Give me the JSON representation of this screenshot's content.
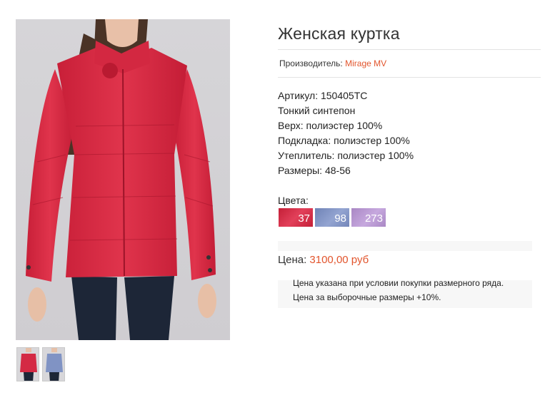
{
  "product": {
    "title": "Женская куртка",
    "manufacturer_label": "Производитель:",
    "manufacturer_name": "Mirage MV",
    "specs": [
      "Артикул: 150405ТС",
      "Тонкий синтепон",
      "Верх: полиэстер 100%",
      "Подкладка: полиэстер 100%",
      "Утеплитель: полиэстер 100%",
      "Размеры: 48-56"
    ],
    "colors_label": "Цвета:",
    "colors": [
      {
        "code": "37",
        "color": "#d42a44"
      },
      {
        "code": "98",
        "color": "#8093c4"
      },
      {
        "code": "273",
        "color": "#b797d1"
      }
    ],
    "price_label": "Цена:",
    "price_value": "3100,00 руб",
    "notes": [
      "Цена указана при условии покупки размерного ряда.",
      "Цена за выборочные размеры +10%."
    ]
  },
  "gallery": {
    "main_image": "red-jacket-photo",
    "thumbnails": [
      "red-jacket-thumb",
      "blue-jacket-thumb"
    ]
  },
  "colors": {
    "accent": "#e2552d",
    "jacket_red": "#d42a44",
    "jacket_blue": "#8093c4"
  }
}
